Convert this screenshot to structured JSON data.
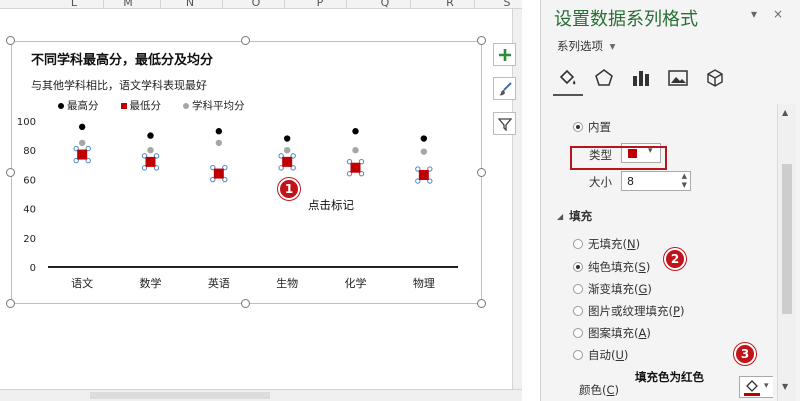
{
  "spreadsheet": {
    "columns": [
      "L",
      "M",
      "N",
      "O",
      "P",
      "Q",
      "R",
      "S"
    ]
  },
  "chart": {
    "title": "不同学科最高分，最低分及均分",
    "subtitle": "与其他学科相比，语文学科表现最好"
  },
  "chart_data": {
    "type": "scatter",
    "categories": [
      "语文",
      "数学",
      "英语",
      "生物",
      "化学",
      "物理"
    ],
    "series": [
      {
        "name": "最高分",
        "values": [
          96,
          90,
          93,
          88,
          93,
          88
        ],
        "color": "#000000",
        "marker": "circle"
      },
      {
        "name": "最低分",
        "values": [
          77,
          72,
          64,
          72,
          68,
          63
        ],
        "color": "#c00000",
        "marker": "square"
      },
      {
        "name": "学科平均分",
        "values": [
          85,
          80,
          85,
          80,
          80,
          79
        ],
        "color": "#a6a6a6",
        "marker": "circle"
      }
    ],
    "y_ticks": [
      0,
      20,
      40,
      60,
      80,
      100
    ],
    "ylim": [
      0,
      100
    ],
    "grid": false,
    "legend": "top"
  },
  "annotations": {
    "badge_1": "1",
    "badge_1_text": "点击标记",
    "badge_2": "2",
    "badge_3": "3",
    "badge_3_text": "填充色为红色"
  },
  "pane": {
    "title": "设置数据系列格式",
    "options_label": "系列选项",
    "close": "×",
    "marker_builtin": "内置",
    "type_label": "类型",
    "size_label": "大小",
    "size_value": "8",
    "fill_header": "填充",
    "fill_options": [
      {
        "label": "无填充(",
        "key": "N",
        "suffix": ")",
        "checked": false
      },
      {
        "label": "纯色填充(",
        "key": "S",
        "suffix": ")",
        "checked": true
      },
      {
        "label": "渐变填充(",
        "key": "G",
        "suffix": ")",
        "checked": false
      },
      {
        "label": "图片或纹理填充(",
        "key": "P",
        "suffix": ")",
        "checked": false
      },
      {
        "label": "图案填充(",
        "key": "A",
        "suffix": ")",
        "checked": false
      },
      {
        "label": "自动(",
        "key": "U",
        "suffix": ")",
        "checked": false
      }
    ],
    "color_label": "颜色(",
    "color_key": "C",
    "color_suffix": ")",
    "fill_color": "#c00000"
  }
}
